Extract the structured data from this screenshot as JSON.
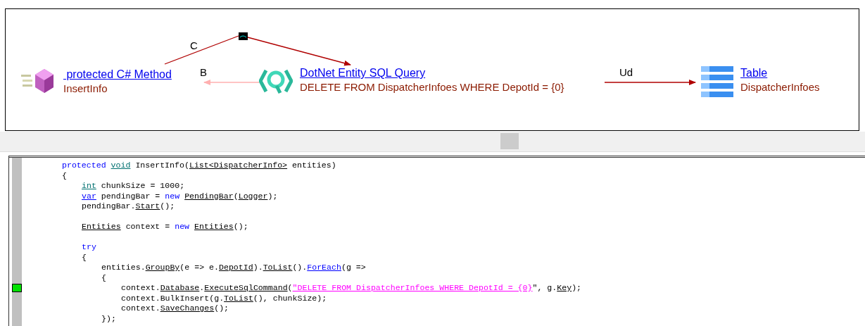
{
  "diagram": {
    "nodes": [
      {
        "kind": "method",
        "title": " protected C# Method",
        "subtitle": "InsertInfo"
      },
      {
        "kind": "query",
        "title": "DotNet Entity SQL Query",
        "subtitle": "DELETE FROM DispatcherInfoes WHERE DepotId = {0}"
      },
      {
        "kind": "table",
        "title": "Table",
        "subtitle": "DispatcherInfoes"
      }
    ],
    "edges": [
      {
        "label": "C",
        "color": "#b00000"
      },
      {
        "label": "B",
        "color": "#ffb0b0"
      },
      {
        "label": "Ud",
        "color": "#b00000"
      }
    ]
  },
  "editor": {
    "lines": [
      {
        "kind": "code",
        "marked": false,
        "tokens": [
          {
            "kind": "keyword",
            "text": "protected "
          },
          {
            "kind": "type",
            "text": "void"
          },
          {
            "kind": "plain",
            "text": " InsertInfo("
          },
          {
            "kind": "ref",
            "text": "List<DispatcherInfo>"
          },
          {
            "kind": "plain",
            "text": " entities)"
          }
        ]
      },
      {
        "kind": "code",
        "marked": false,
        "tokens": [
          {
            "kind": "plain",
            "text": "{"
          }
        ],
        "children": [
          {
            "kind": "code",
            "marked": false,
            "tokens": [
              {
                "kind": "type",
                "text": "int"
              },
              {
                "kind": "plain",
                "text": " chunkSize = 1000;"
              }
            ]
          },
          {
            "kind": "code",
            "marked": false,
            "tokens": [
              {
                "kind": "keyword_ref",
                "text": "var"
              },
              {
                "kind": "plain",
                "text": " pendingBar = "
              },
              {
                "kind": "keyword",
                "text": "new "
              },
              {
                "kind": "ref",
                "text": "PendingBar"
              },
              {
                "kind": "plain",
                "text": "("
              },
              {
                "kind": "ref",
                "text": "Logger"
              },
              {
                "kind": "plain",
                "text": ");"
              }
            ]
          },
          {
            "kind": "code",
            "marked": false,
            "tokens": [
              {
                "kind": "plain",
                "text": "pendingBar."
              },
              {
                "kind": "ref",
                "text": "Start"
              },
              {
                "kind": "plain",
                "text": "();"
              }
            ]
          },
          {
            "kind": "blank",
            "marked": false
          },
          {
            "kind": "code",
            "marked": false,
            "tokens": [
              {
                "kind": "ref",
                "text": "Entities"
              },
              {
                "kind": "plain",
                "text": " context = "
              },
              {
                "kind": "keyword",
                "text": "new "
              },
              {
                "kind": "ref",
                "text": "Entities"
              },
              {
                "kind": "plain",
                "text": "();"
              }
            ]
          },
          {
            "kind": "blank",
            "marked": false
          },
          {
            "kind": "code",
            "marked": false,
            "tokens": [
              {
                "kind": "keyword",
                "text": "try"
              }
            ]
          },
          {
            "kind": "code",
            "marked": false,
            "tokens": [
              {
                "kind": "plain",
                "text": "{"
              }
            ],
            "children": [
              {
                "kind": "code",
                "marked": false,
                "tokens": [
                  {
                    "kind": "plain",
                    "text": "entities."
                  },
                  {
                    "kind": "ref",
                    "text": "GroupBy"
                  },
                  {
                    "kind": "plain",
                    "text": "(e => e."
                  },
                  {
                    "kind": "ref",
                    "text": "DepotId"
                  },
                  {
                    "kind": "plain",
                    "text": ")."
                  },
                  {
                    "kind": "ref",
                    "text": "ToList"
                  },
                  {
                    "kind": "plain",
                    "text": "()."
                  },
                  {
                    "kind": "keyword_ref",
                    "text": "ForEach"
                  },
                  {
                    "kind": "plain",
                    "text": "(g =>"
                  }
                ]
              },
              {
                "kind": "code",
                "marked": false,
                "tokens": [
                  {
                    "kind": "plain",
                    "text": "{"
                  }
                ],
                "children": [
                  {
                    "kind": "code",
                    "marked": true,
                    "tokens": [
                      {
                        "kind": "plain",
                        "text": "context."
                      },
                      {
                        "kind": "ref",
                        "text": "Database"
                      },
                      {
                        "kind": "plain",
                        "text": "."
                      },
                      {
                        "kind": "ref",
                        "text": "ExecuteSqlCommand"
                      },
                      {
                        "kind": "plain",
                        "text": "("
                      },
                      {
                        "kind": "string",
                        "text": "\"DELETE FROM DispatcherInfoes WHERE DepotId = {0}"
                      },
                      {
                        "kind": "plain",
                        "text": "\", g."
                      },
                      {
                        "kind": "ref",
                        "text": "Key"
                      },
                      {
                        "kind": "plain",
                        "text": ");"
                      }
                    ]
                  },
                  {
                    "kind": "code",
                    "marked": false,
                    "tokens": [
                      {
                        "kind": "plain",
                        "text": "context.BulkInsert(g."
                      },
                      {
                        "kind": "ref",
                        "text": "ToList"
                      },
                      {
                        "kind": "plain",
                        "text": "(), chunkSize);"
                      }
                    ]
                  },
                  {
                    "kind": "code",
                    "marked": false,
                    "tokens": [
                      {
                        "kind": "plain",
                        "text": "context."
                      },
                      {
                        "kind": "ref",
                        "text": "SaveChanges"
                      },
                      {
                        "kind": "plain",
                        "text": "();"
                      }
                    ]
                  }
                ]
              },
              {
                "kind": "code",
                "marked": false,
                "tokens": [
                  {
                    "kind": "plain",
                    "text": "});"
                  }
                ]
              }
            ]
          }
        ]
      }
    ]
  }
}
